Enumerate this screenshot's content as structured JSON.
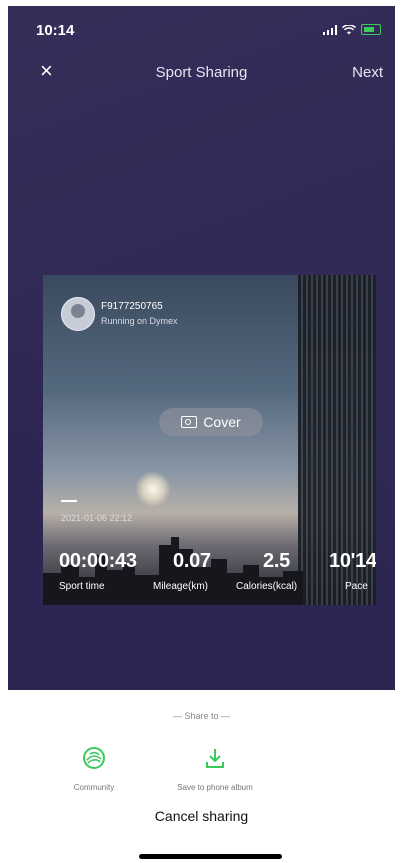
{
  "status_bar": {
    "time": "10:14"
  },
  "nav": {
    "close_symbol": "×",
    "title": "Sport Sharing",
    "next_label": "Next"
  },
  "card": {
    "user_name": "F9177250765",
    "user_subtitle": "Running on Dymex",
    "cover_label": "Cover",
    "date": "2021-01-06 22:12",
    "stats": [
      {
        "value": "00:00:43",
        "label": "Sport time"
      },
      {
        "value": "0.07",
        "label": "Mileage(km)"
      },
      {
        "value": "2.5",
        "label": "Calories(kcal)"
      },
      {
        "value": "10'14\"",
        "label": "Pace"
      }
    ]
  },
  "share": {
    "header": "— Share to —",
    "options": [
      {
        "label": "Community",
        "icon": "community-icon"
      },
      {
        "label": "Save to phone album",
        "icon": "download-icon"
      }
    ],
    "cancel_label": "Cancel sharing"
  },
  "colors": {
    "background": "#2d2653",
    "accent": "#3acb5c"
  }
}
